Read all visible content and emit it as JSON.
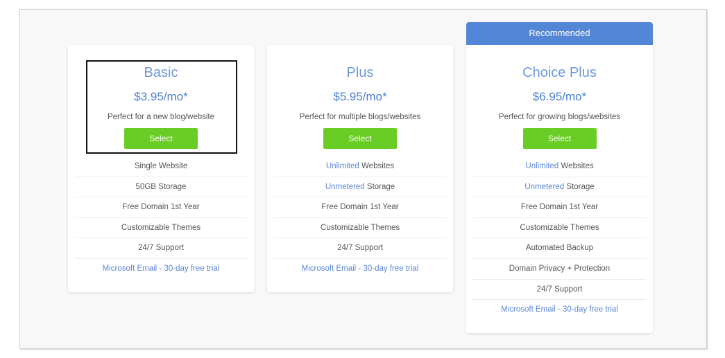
{
  "recommended_label": "Recommended",
  "colors": {
    "accent_blue": "#5486d8",
    "plan_name": "#6f97db",
    "price": "#4c7fd1",
    "select_green": "#6acd26",
    "link_blue": "#5b87d6"
  },
  "plans": [
    {
      "name": "Basic",
      "price": "$3.95/mo*",
      "description": "Perfect for a new blog/website",
      "select_label": "Select",
      "features": [
        {
          "highlight": "",
          "text": "Single Website"
        },
        {
          "highlight": "",
          "text": "50GB Storage"
        },
        {
          "highlight": "",
          "text": "Free Domain 1st Year"
        },
        {
          "highlight": "",
          "text": "Customizable Themes"
        },
        {
          "highlight": "",
          "text": "24/7 Support"
        }
      ],
      "email_link": "Microsoft Email - 30-day free trial"
    },
    {
      "name": "Plus",
      "price": "$5.95/mo*",
      "description": "Perfect for multiple blogs/websites",
      "select_label": "Select",
      "features": [
        {
          "highlight": "Unlimited",
          "text": " Websites"
        },
        {
          "highlight": "Unmetered",
          "text": " Storage"
        },
        {
          "highlight": "",
          "text": "Free Domain 1st Year"
        },
        {
          "highlight": "",
          "text": "Customizable Themes"
        },
        {
          "highlight": "",
          "text": "24/7 Support"
        }
      ],
      "email_link": "Microsoft Email - 30-day free trial"
    },
    {
      "name": "Choice Plus",
      "price": "$6.95/mo*",
      "description": "Perfect for growing blogs/websites",
      "select_label": "Select",
      "features": [
        {
          "highlight": "Unlimited",
          "text": " Websites"
        },
        {
          "highlight": "Unmetered",
          "text": " Storage"
        },
        {
          "highlight": "",
          "text": "Free Domain 1st Year"
        },
        {
          "highlight": "",
          "text": "Customizable Themes"
        },
        {
          "highlight": "",
          "text": "Automated Backup"
        },
        {
          "highlight": "",
          "text": "Domain Privacy + Protection"
        },
        {
          "highlight": "",
          "text": "24/7 Support"
        }
      ],
      "email_link": "Microsoft Email - 30-day free trial"
    }
  ]
}
